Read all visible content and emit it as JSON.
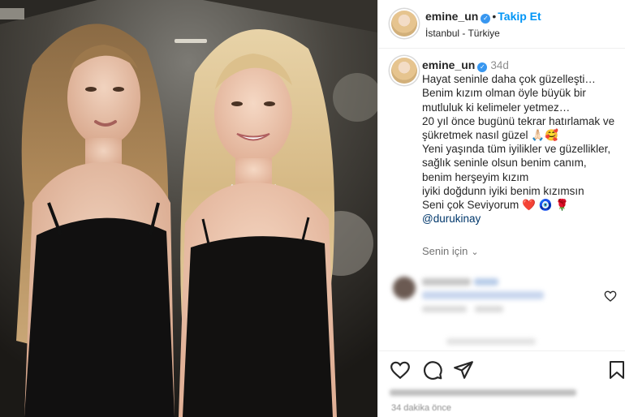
{
  "post": {
    "username": "emine_un",
    "follow_label": "Takip Et",
    "location": "İstanbul - Türkiye"
  },
  "caption": {
    "username": "emine_un",
    "time": "34d",
    "lines": [
      "Hayat seninle daha çok güzelleşti…",
      "Benim kızım olman öyle büyük bir",
      "mutluluk ki kelimeler yetmez…",
      "20 yıl önce bugünü tekrar hatırlamak ve",
      "şükretmek nasıl güzel 🙏🏻🥰",
      "Yeni yaşında tüm iyilikler ve güzellikler,",
      "sağlık seninle olsun benim canım,",
      "benim herşeyim kızım",
      "iyiki doğdunn iyiki benim kızımsın",
      "Seni çok Seviyorum ❤️ 🧿 🌹"
    ],
    "mention": "@durukinay",
    "see_translation": "Senin için"
  },
  "footer": {
    "age": "34 dakika önce"
  },
  "icons": [
    "verified-icon",
    "chevron-down-icon",
    "heart-icon",
    "comment-icon",
    "share-icon",
    "save-icon"
  ],
  "colors": {
    "link": "#0095f6",
    "mention": "#00376b",
    "muted": "#8e8e8e",
    "heart": "#ed4956"
  }
}
